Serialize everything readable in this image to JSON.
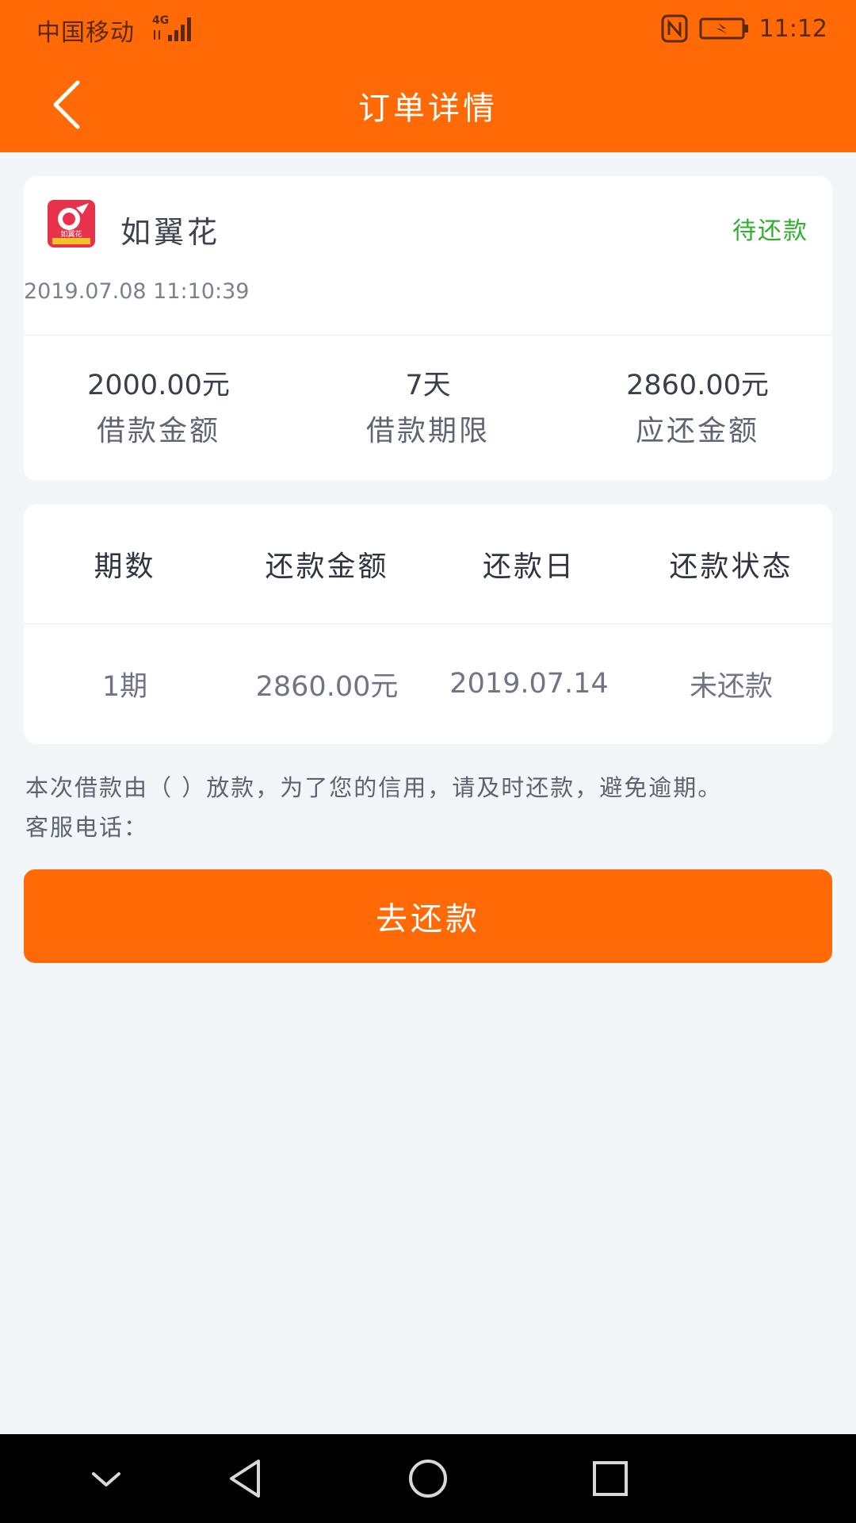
{
  "status_bar": {
    "carrier": "中国移动",
    "network": "4G",
    "time": "11:12"
  },
  "nav": {
    "title": "订单详情"
  },
  "order": {
    "app_name": "如翼花",
    "logo_text": "如翼花",
    "status": "待还款",
    "datetime": "2019.07.08 11:10:39",
    "summary": [
      {
        "value": "2000.00元",
        "label": "借款金额"
      },
      {
        "value": "7天",
        "label": "借款期限"
      },
      {
        "value": "2860.00元",
        "label": "应还金额"
      }
    ]
  },
  "table": {
    "headers": [
      "期数",
      "还款金额",
      "还款日",
      "还款状态"
    ],
    "rows": [
      [
        "1期",
        "2860.00元",
        "2019.07.14",
        "未还款"
      ]
    ]
  },
  "notice": {
    "line1": "本次借款由（ ）放款，为了您的信用，请及时还款，避免逾期。",
    "line2": "客服电话："
  },
  "repay_button": {
    "label": "去还款"
  },
  "colors": {
    "brand_orange": "#ff6a06",
    "status_green": "#2eb02e",
    "page_bg": "#f3f6f9"
  },
  "icons": {
    "back": "chevron-left-icon",
    "nfc": "nfc-icon",
    "battery": "battery-charging-icon",
    "signal": "signal-icon",
    "sys_down": "chevron-down-icon",
    "sys_back": "triangle-back-icon",
    "sys_home": "circle-home-icon",
    "sys_recent": "square-recent-icon"
  }
}
